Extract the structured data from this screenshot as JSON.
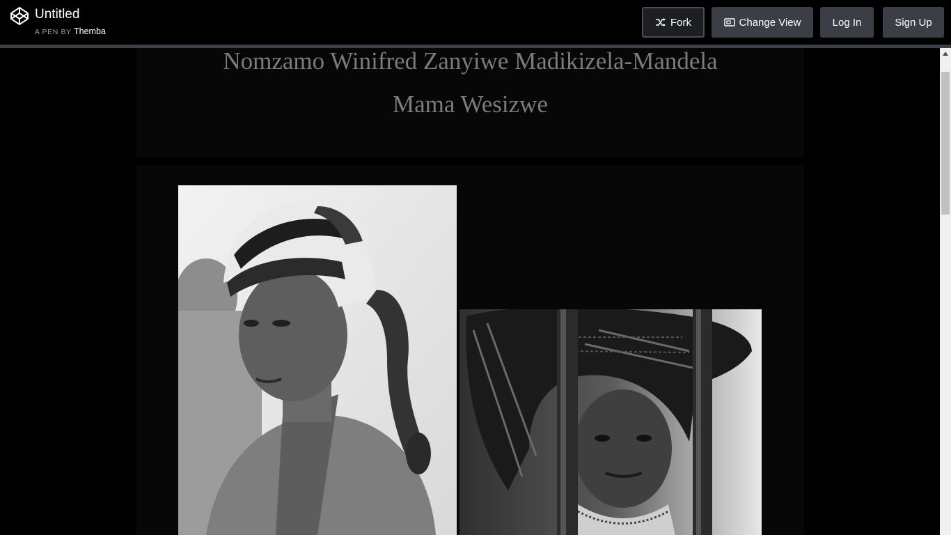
{
  "header": {
    "title": "Untitled",
    "byline_prefix": "A PEN BY",
    "author": "Themba",
    "buttons": {
      "fork": "Fork",
      "change_view": "Change View",
      "login": "Log In",
      "signup": "Sign Up"
    }
  },
  "page": {
    "heading_name": "Nomzamo Winifred Zanyiwe Madikizela-Mandela",
    "heading_title": "Mama Wesizwe"
  }
}
